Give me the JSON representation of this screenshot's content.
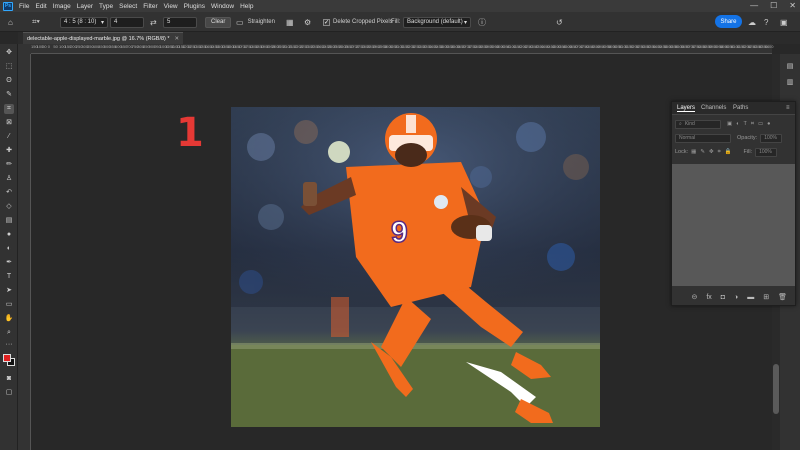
{
  "app": {
    "logo": "Ps"
  },
  "menu": [
    "File",
    "Edit",
    "Image",
    "Layer",
    "Type",
    "Select",
    "Filter",
    "View",
    "Plugins",
    "Window",
    "Help"
  ],
  "window_controls": [
    "—",
    "☐",
    "✕"
  ],
  "options": {
    "ratio": "4 : 5 (8 : 10)",
    "width": "4",
    "height": "5",
    "clear_label": "Clear",
    "straighten_label": "Straighten",
    "delete_cropped_label": "Delete Cropped Pixels",
    "delete_cropped_checked": true,
    "fill_label": "Fill:",
    "fill_value": "Background (default)",
    "share_label": "Share"
  },
  "document": {
    "tab_title": "delectable-apple-displayed-marble.jpg @ 16.7% (RGB/8) *"
  },
  "ruler_ticks": [
    "150",
    "100",
    "50",
    "0",
    "50",
    "100",
    "150",
    "200",
    "250",
    "300",
    "350",
    "400",
    "450",
    "500",
    "550",
    "600",
    "650",
    "700",
    "750",
    "800",
    "850",
    "900",
    "950",
    "1000",
    "1050",
    "1100",
    "1150",
    "1200",
    "1250",
    "1300",
    "1350",
    "1400",
    "1450",
    "1500",
    "1550",
    "1600",
    "1650",
    "1700",
    "1750",
    "1800",
    "1850",
    "1900",
    "1950",
    "2000",
    "2050",
    "2100",
    "2150",
    "2200",
    "2250",
    "2300",
    "2350",
    "2400",
    "2450",
    "2500",
    "2550",
    "2600",
    "2650",
    "2700",
    "2750",
    "2800",
    "2850",
    "2900",
    "2950",
    "3000",
    "3050",
    "3100",
    "3150",
    "3200",
    "3250",
    "3300",
    "3350",
    "3400",
    "3450",
    "3500",
    "3550",
    "3600",
    "3650",
    "3700",
    "3750",
    "3800",
    "3850",
    "3900",
    "3950",
    "4000",
    "4050",
    "4100",
    "4150",
    "4200",
    "4250",
    "4300",
    "4350",
    "4400",
    "4450",
    "4500",
    "4550",
    "4600",
    "4650",
    "4700",
    "4750",
    "4800",
    "4850",
    "4900",
    "4950",
    "5000",
    "5050",
    "5100",
    "5150",
    "5200",
    "5250",
    "5300",
    "5350",
    "5400",
    "5450",
    "5500",
    "5550",
    "5600",
    "5650",
    "5700",
    "5750",
    "5800",
    "5850",
    "5900",
    "5950",
    "6000",
    "6050",
    "6100",
    "6150",
    "6200",
    "6250",
    "6300",
    "6350",
    "6400",
    "6450",
    "6500"
  ],
  "overlay": {
    "step_number": "1"
  },
  "photo": {
    "jersey_number": "9"
  },
  "colors": {
    "foreground": "#e02020",
    "background": "#111111",
    "accent": "#1473e6",
    "jersey": "#f26b1d"
  },
  "layers_panel": {
    "tabs": [
      "Layers",
      "Channels",
      "Paths"
    ],
    "search_placeholder": "Kind",
    "blend_mode": "Normal",
    "opacity_label": "Opacity:",
    "opacity_value": "100%",
    "lock_label": "Lock:",
    "fill_label": "Fill:",
    "fill_value": "100%"
  }
}
